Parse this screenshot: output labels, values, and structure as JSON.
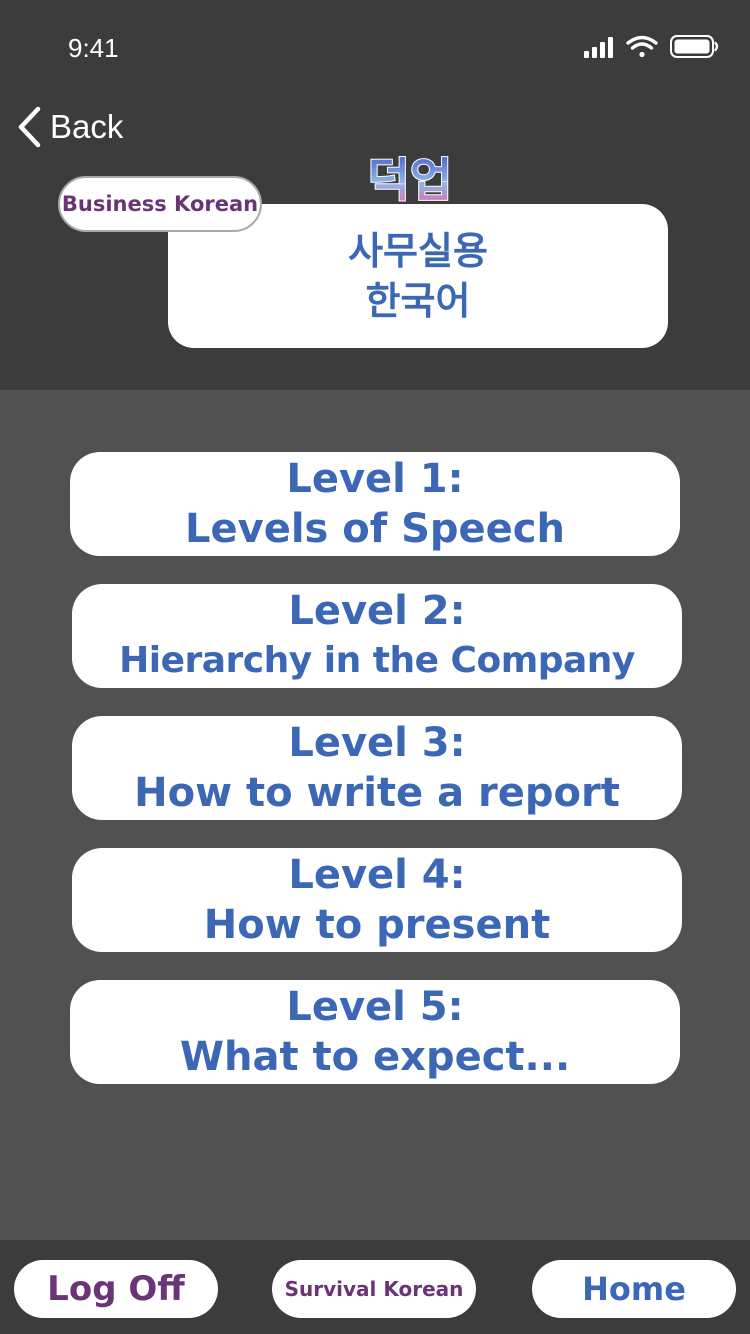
{
  "status_bar": {
    "time": "9:41",
    "signal_icon": "cellular-signal-icon",
    "wifi_icon": "wifi-icon",
    "battery_icon": "battery-icon"
  },
  "nav": {
    "back_label": "Back",
    "back_icon": "chevron-left-icon"
  },
  "header": {
    "badge_label": "Business Korean",
    "title_line1": "사무실용",
    "title_line2": "한국어",
    "logo_text": "덕업"
  },
  "levels": [
    {
      "title": "Level 1:",
      "subtitle": "Levels of Speech"
    },
    {
      "title": "Level 2:",
      "subtitle": "Hierarchy in the Company"
    },
    {
      "title": "Level 3:",
      "subtitle": "How to write a report"
    },
    {
      "title": "Level 4:",
      "subtitle": "How to present"
    },
    {
      "title": "Level 5:",
      "subtitle": "What to expect..."
    }
  ],
  "footer": {
    "logoff_label": "Log Off",
    "survival_label": "Survival Korean",
    "home_label": "Home"
  },
  "colors": {
    "header_bg": "#3c3c3c",
    "body_bg": "#515151",
    "accent_blue": "#3b67b5",
    "accent_purple": "#6b3476"
  }
}
